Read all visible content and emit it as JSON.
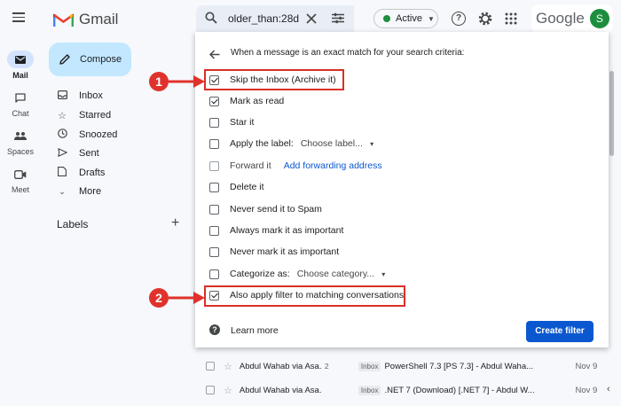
{
  "header": {
    "app_name": "Gmail",
    "search_value": "older_than:28d",
    "status_label": "Active",
    "google_label": "Google",
    "avatar_letter": "S"
  },
  "rail": {
    "items": [
      {
        "label": "Mail",
        "icon": "mail-icon"
      },
      {
        "label": "Chat",
        "icon": "chat-icon"
      },
      {
        "label": "Spaces",
        "icon": "spaces-icon"
      },
      {
        "label": "Meet",
        "icon": "meet-icon"
      }
    ]
  },
  "sidebar": {
    "compose_label": "Compose",
    "items": [
      {
        "label": "Inbox",
        "icon": "inbox-icon"
      },
      {
        "label": "Starred",
        "icon": "star-icon"
      },
      {
        "label": "Snoozed",
        "icon": "clock-icon"
      },
      {
        "label": "Sent",
        "icon": "send-icon"
      },
      {
        "label": "Drafts",
        "icon": "draft-icon"
      },
      {
        "label": "More",
        "icon": "chevron-down-icon"
      }
    ],
    "labels_title": "Labels"
  },
  "dialog": {
    "header_text": "When a message is an exact match for your search criteria:",
    "options": [
      {
        "label": "Skip the Inbox (Archive it)",
        "checked": true
      },
      {
        "label": "Mark as read",
        "checked": true
      },
      {
        "label": "Star it",
        "checked": false
      },
      {
        "label": "Apply the label:",
        "checked": false,
        "dropdown": "Choose label..."
      },
      {
        "label": "Forward it",
        "checked": false,
        "link": "Add forwarding address"
      },
      {
        "label": "Delete it",
        "checked": false
      },
      {
        "label": "Never send it to Spam",
        "checked": false
      },
      {
        "label": "Always mark it as important",
        "checked": false
      },
      {
        "label": "Never mark it as important",
        "checked": false
      },
      {
        "label": "Categorize as:",
        "checked": false,
        "dropdown": "Choose category..."
      },
      {
        "label": "Also apply filter to matching conversations.",
        "checked": true
      }
    ],
    "learn_more": "Learn more",
    "create_filter": "Create filter"
  },
  "callouts": [
    "1",
    "2"
  ],
  "emails": [
    {
      "sender": "Abdul Wahab via Asa.",
      "count": "2",
      "tag": "Inbox",
      "subject": "PowerShell 7.3 [PS 7.3] - Abdul Waha...",
      "date": "Nov 9"
    },
    {
      "sender": "Abdul Wahab via Asa.",
      "count": "",
      "tag": "Inbox",
      "subject": ".NET 7 (Download) [.NET 7] - Abdul W...",
      "date": "Nov 9"
    }
  ],
  "colors": {
    "accent": "#0b57d0",
    "callout": "#e0322c",
    "compose_bg": "#c2e7ff"
  }
}
